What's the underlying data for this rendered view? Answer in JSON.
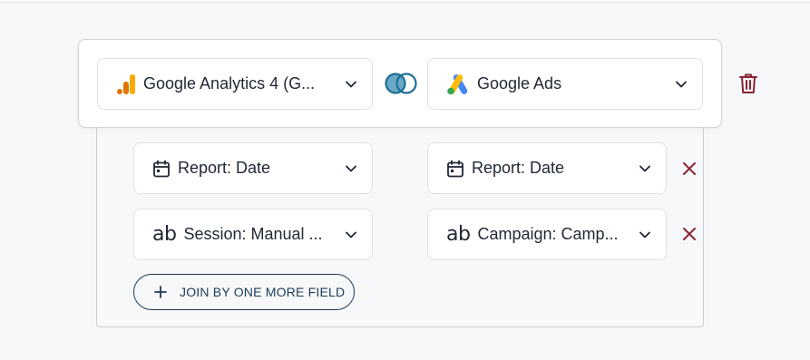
{
  "source_left": {
    "label": "Google Analytics 4 (G...",
    "icon": "google-analytics-icon"
  },
  "source_right": {
    "label": "Google Ads",
    "icon": "google-ads-icon"
  },
  "join_icon": "join-venn-icon",
  "delete_icon": "trash-icon",
  "field_pairs": [
    {
      "left": {
        "label": "Report: Date",
        "icon": "calendar-icon"
      },
      "right": {
        "label": "Report: Date",
        "icon": "calendar-icon"
      }
    },
    {
      "left": {
        "label": "Session: Manual ...",
        "icon": "text-ab-icon",
        "icon_text": "ab"
      },
      "right": {
        "label": "Campaign: Camp...",
        "icon": "text-ab-icon",
        "icon_text": "ab"
      }
    }
  ],
  "join_more_button": {
    "label": "JOIN BY ONE MORE FIELD"
  },
  "colors": {
    "accent": "#1b3a57",
    "danger": "#8b2332",
    "join_icon": "#1d6f95",
    "ga_orange": "#f9ab00",
    "ga_dark_orange": "#e37400",
    "ads_blue": "#4285f4",
    "ads_yellow": "#fbbc04",
    "ads_green": "#34a853"
  }
}
